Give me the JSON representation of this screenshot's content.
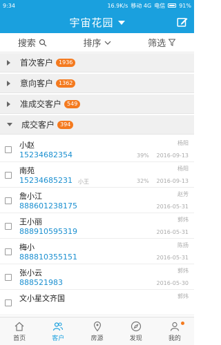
{
  "status_bar": {
    "time": "9:34",
    "speed": "16.9K/s",
    "carrier1": "移动 4G",
    "carrier2": "电信",
    "battery": "91%"
  },
  "header": {
    "title": "宇宙花园"
  },
  "filters": [
    {
      "label": "搜索"
    },
    {
      "label": "排序"
    },
    {
      "label": "筛选"
    }
  ],
  "groups": [
    {
      "label": "首次客户",
      "count": "1936"
    },
    {
      "label": "意向客户",
      "count": "1362"
    },
    {
      "label": "准成交客户",
      "count": "549"
    },
    {
      "label": "成交客户",
      "count": "394"
    }
  ],
  "customers": [
    {
      "name": "小赵",
      "phone": "15234682354",
      "agent": "杨阳",
      "mid": "",
      "percent": "39%",
      "date": "2016-09-13"
    },
    {
      "name": "南苑",
      "phone": "15234685231",
      "agent": "杨阳",
      "mid": "小王",
      "percent": "32%",
      "date": "2016-09-13"
    },
    {
      "name": "詹小江",
      "phone": "888601238175",
      "agent": "赵芳",
      "mid": "",
      "percent": "",
      "date": "2016-05-31"
    },
    {
      "name": "王小丽",
      "phone": "888910595319",
      "agent": "郭炜",
      "mid": "",
      "percent": "",
      "date": "2016-05-31"
    },
    {
      "name": "梅小",
      "phone": "888810355151",
      "agent": "陈扬",
      "mid": "",
      "percent": "",
      "date": "2016-05-31"
    },
    {
      "name": "张小云",
      "phone": "888521983",
      "agent": "郭炜",
      "mid": "",
      "percent": "",
      "date": "2016-05-30"
    },
    {
      "name": "文小星文齐国",
      "phone": "",
      "agent": "郭炜",
      "mid": "",
      "percent": "",
      "date": ""
    }
  ],
  "tabs": [
    {
      "label": "首页",
      "icon": "home-icon"
    },
    {
      "label": "客户",
      "icon": "customer-icon"
    },
    {
      "label": "房源",
      "icon": "location-icon"
    },
    {
      "label": "发现",
      "icon": "compass-icon"
    },
    {
      "label": "我的",
      "icon": "user-icon"
    }
  ],
  "colors": {
    "primary": "#1aa0de",
    "badge": "#f47a1f",
    "phone": "#1a8fd0"
  }
}
